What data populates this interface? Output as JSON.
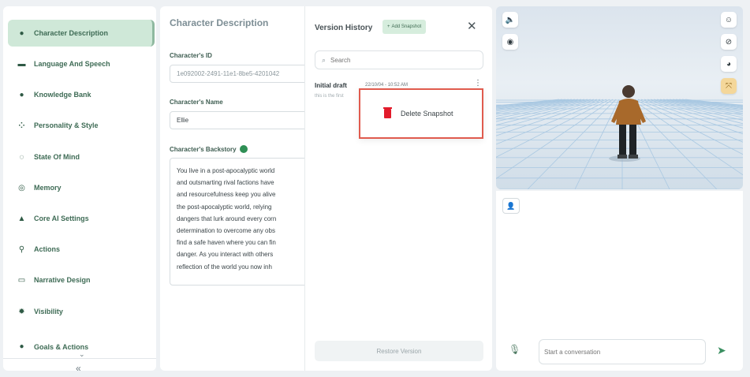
{
  "sidebar": {
    "items": [
      {
        "label": "Character Description",
        "icon": "user-icon",
        "active": true
      },
      {
        "label": "Language And Speech",
        "icon": "keyboard-icon"
      },
      {
        "label": "Knowledge Bank",
        "icon": "bulb-icon"
      },
      {
        "label": "Personality & Style",
        "icon": "sparkle-icon"
      },
      {
        "label": "State Of Mind",
        "icon": "mind-icon"
      },
      {
        "label": "Memory",
        "icon": "memory-icon"
      },
      {
        "label": "Core AI Settings",
        "icon": "triangle-icon"
      },
      {
        "label": "Actions",
        "icon": "run-icon"
      },
      {
        "label": "Narrative Design",
        "icon": "book-icon"
      },
      {
        "label": "Visibility",
        "icon": "gear-icon"
      },
      {
        "label": "Goals & Actions",
        "icon": "target-icon"
      }
    ],
    "collapse_glyph": "«",
    "chevron_glyph": "⌄"
  },
  "main": {
    "title": "Character Description",
    "id_label": "Character's ID",
    "id_value": "1e092002-2491-11e1-8be5-4201042",
    "name_label": "Character's Name",
    "name_value": "Ellie",
    "backstory_label": "Character's Backstory",
    "backstory": "You live in a post-apocalyptic world\nand outsmarting rival factions have\nand resourcefulness keep you alive\nthe post-apocalyptic world, relying\ndangers that lurk around every corn\ndetermination to overcome any obs\nfind a safe haven where you can fin\ndanger. As you interact with others\nreflection of the world you now inh"
  },
  "version_history": {
    "title": "Version History",
    "add_snapshot": "Add Snapshot",
    "add_glyph": "+",
    "close_glyph": "✕",
    "search_placeholder": "Search",
    "draft": {
      "name": "Initial draft",
      "date": "22/10/04 - 10:52 AM",
      "desc": "this is the first"
    },
    "menu": {
      "delete_label": "Delete Snapshot"
    },
    "restore_label": "Restore Version"
  },
  "viewer": {
    "tools_left": [
      {
        "icon": "speaker-icon",
        "glyph": "🔈"
      },
      {
        "icon": "eye-icon",
        "glyph": "◉"
      }
    ],
    "tools_right": [
      {
        "icon": "face-icon",
        "glyph": "☺"
      },
      {
        "icon": "compass-icon",
        "glyph": "⊘"
      },
      {
        "icon": "head-icon",
        "glyph": "◕"
      },
      {
        "icon": "expand-icon",
        "glyph": "⤧",
        "active": true
      }
    ]
  },
  "chat": {
    "user_glyph": "👤",
    "mic_glyph": "🎙",
    "placeholder": "Start a conversation",
    "send_glyph": "➤"
  },
  "colors": {
    "accent_green": "#3a8f61",
    "active_tab": "#cfe8d8",
    "delete_red": "#e21b2b",
    "highlight_border": "#e05b4e"
  }
}
